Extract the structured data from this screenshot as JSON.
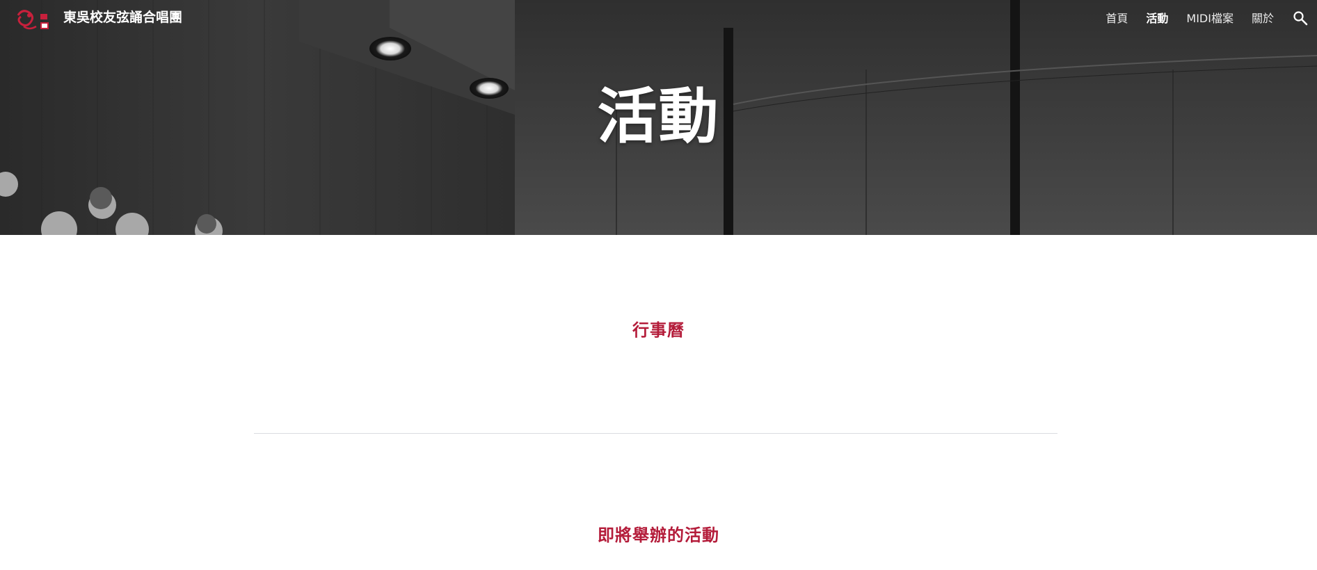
{
  "site": {
    "name": "東吳校友弦誦合唱團"
  },
  "nav": {
    "items": [
      {
        "label": "首頁",
        "active": false
      },
      {
        "label": "活動",
        "active": true
      },
      {
        "label": "MIDI檔案",
        "active": false
      },
      {
        "label": "關於",
        "active": false
      }
    ],
    "search_icon": "search-icon"
  },
  "hero": {
    "title": "活動"
  },
  "sections": {
    "calendar_heading": "行事曆",
    "upcoming_heading": "即將舉辦的活動"
  },
  "colors": {
    "accent": "#b41c3a",
    "divider": "#dadce0",
    "hero_overlay": "#2c2c2c"
  }
}
